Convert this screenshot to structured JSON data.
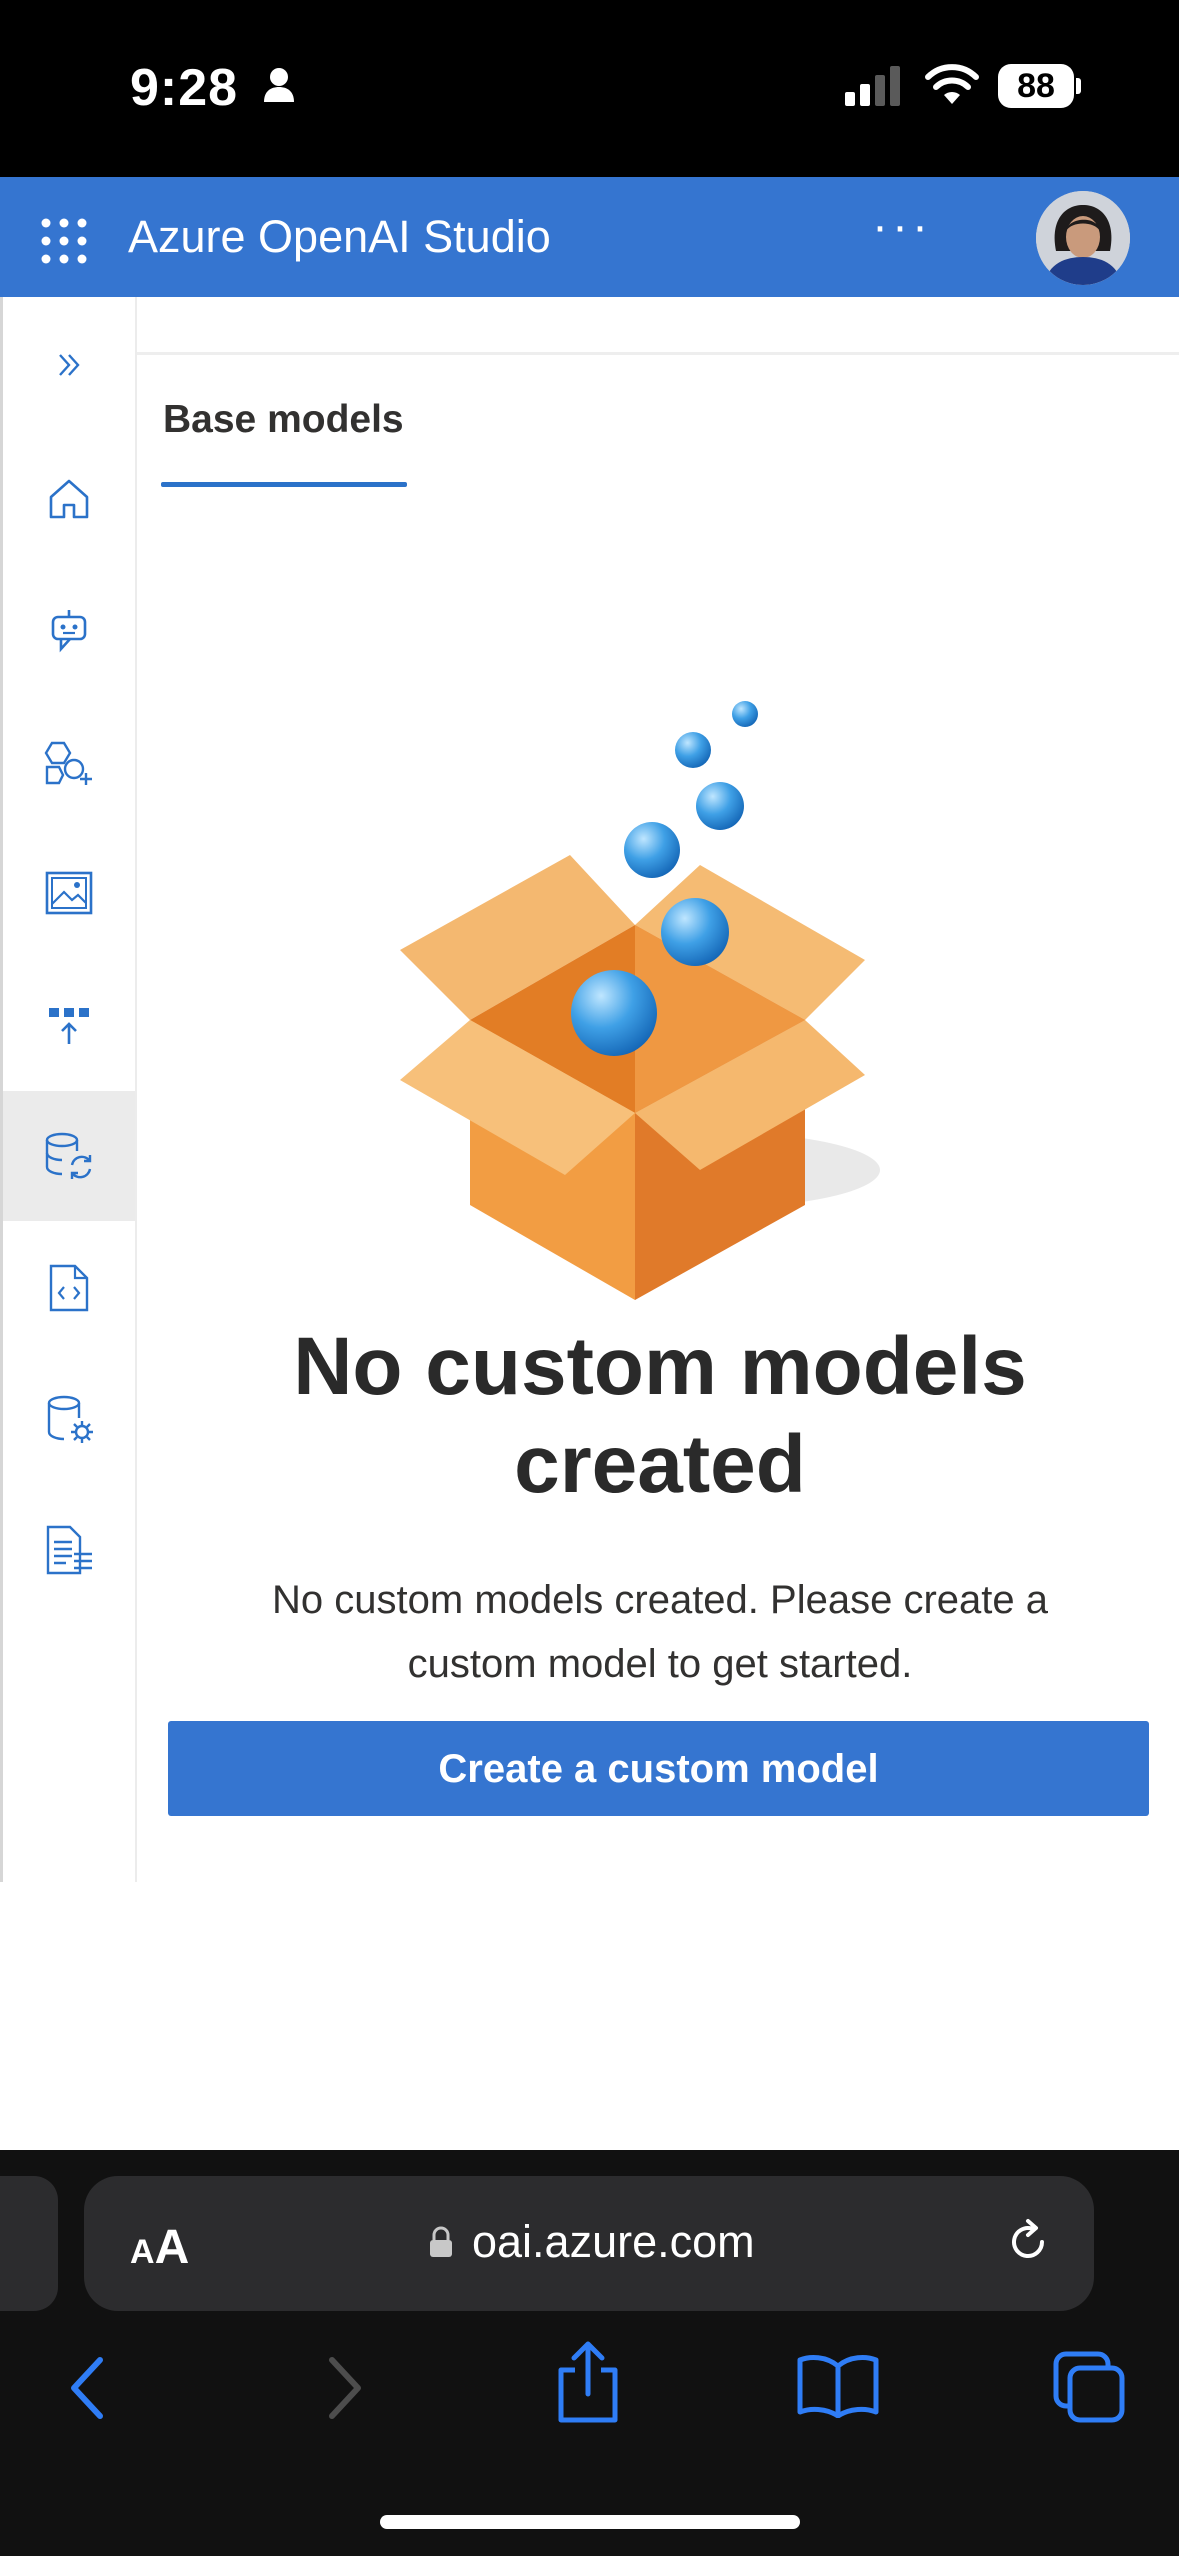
{
  "status_bar": {
    "time": "9:28",
    "battery": "88"
  },
  "header": {
    "app_title": "Azure OpenAI Studio",
    "more_label": "···"
  },
  "sidebar": {
    "items": [
      {
        "icon": "expand-chevrons-icon"
      },
      {
        "icon": "home-icon"
      },
      {
        "icon": "chatbot-icon"
      },
      {
        "icon": "shapes-add-icon"
      },
      {
        "icon": "image-icon"
      },
      {
        "icon": "deployments-icon"
      },
      {
        "icon": "models-sync-icon",
        "active": true
      },
      {
        "icon": "code-file-icon"
      },
      {
        "icon": "data-settings-icon"
      },
      {
        "icon": "document-list-icon"
      }
    ]
  },
  "main": {
    "tab_label": "Base models",
    "empty_title": "No custom models created",
    "empty_description": "No custom models created. Please create a custom model to get started.",
    "cta_label": "Create a custom model"
  },
  "browser": {
    "aa_label_small": "A",
    "aa_label_large": "A",
    "url": "oai.azure.com"
  },
  "colors": {
    "brand_blue": "#3575d0",
    "box_orange": "#f0963f",
    "bubble_blue": "#3a9be0"
  }
}
